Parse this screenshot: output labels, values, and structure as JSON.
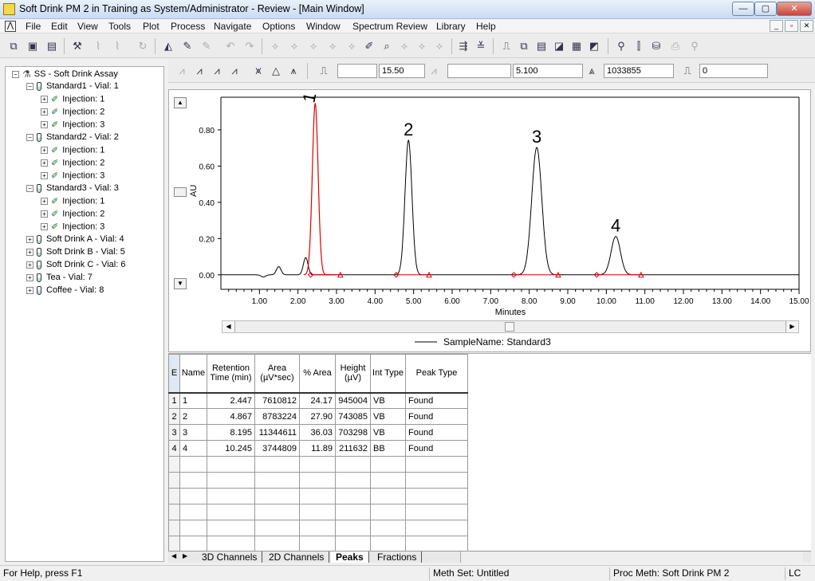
{
  "window": {
    "title": "Soft Drink PM 2 in Training as System/Administrator - Review - [Main Window]",
    "minimize": "—",
    "maximize": "▢",
    "close": "✕"
  },
  "menu": [
    "File",
    "Edit",
    "View",
    "Tools",
    "Plot",
    "Process",
    "Navigate",
    "Options",
    "Window",
    "Spectrum Review",
    "Library",
    "Help"
  ],
  "toolbar2": {
    "field1": "",
    "field2": "15.50",
    "field3": "",
    "field4": "5.100",
    "field5": "1033855",
    "field6": "0"
  },
  "tree": [
    {
      "level": 0,
      "expand": "−",
      "icon": "folder",
      "label": "SS - Soft Drink Assay"
    },
    {
      "level": 1,
      "expand": "−",
      "icon": "vial",
      "label": "Standard1 - Vial: 1"
    },
    {
      "level": 2,
      "expand": "+",
      "icon": "inj",
      "label": "Injection: 1"
    },
    {
      "level": 2,
      "expand": "+",
      "icon": "inj",
      "label": "Injection: 2"
    },
    {
      "level": 2,
      "expand": "+",
      "icon": "inj",
      "label": "Injection: 3"
    },
    {
      "level": 1,
      "expand": "−",
      "icon": "vial",
      "label": "Standard2 - Vial: 2"
    },
    {
      "level": 2,
      "expand": "+",
      "icon": "inj",
      "label": "Injection: 1"
    },
    {
      "level": 2,
      "expand": "+",
      "icon": "inj",
      "label": "Injection: 2"
    },
    {
      "level": 2,
      "expand": "+",
      "icon": "inj",
      "label": "Injection: 3"
    },
    {
      "level": 1,
      "expand": "−",
      "icon": "vial",
      "label": "Standard3 - Vial: 3"
    },
    {
      "level": 2,
      "expand": "+",
      "icon": "inj",
      "label": "Injection: 1"
    },
    {
      "level": 2,
      "expand": "+",
      "icon": "inj",
      "label": "Injection: 2"
    },
    {
      "level": 2,
      "expand": "+",
      "icon": "inj",
      "label": "Injection: 3"
    },
    {
      "level": 1,
      "expand": "+",
      "icon": "vial",
      "label": "Soft Drink A - Vial: 4"
    },
    {
      "level": 1,
      "expand": "+",
      "icon": "vial",
      "label": "Soft Drink B - Vial: 5"
    },
    {
      "level": 1,
      "expand": "+",
      "icon": "vial",
      "label": "Soft Drink C - Vial: 6"
    },
    {
      "level": 1,
      "expand": "+",
      "icon": "vial",
      "label": "Tea - Vial: 7"
    },
    {
      "level": 1,
      "expand": "+",
      "icon": "vial",
      "label": "Coffee - Vial: 8"
    }
  ],
  "chart_data": {
    "type": "line",
    "ylabel": "AU",
    "xlabel": "Minutes",
    "legend": "SampleName: Standard3",
    "xlim": [
      0.0,
      15.0
    ],
    "ylim": [
      -0.08,
      0.98
    ],
    "xticks": [
      "1.00",
      "2.00",
      "3.00",
      "4.00",
      "5.00",
      "6.00",
      "7.00",
      "8.00",
      "9.00",
      "10.00",
      "11.00",
      "12.00",
      "13.00",
      "14.00",
      "15.00"
    ],
    "yticks": [
      "0.00",
      "0.20",
      "0.40",
      "0.60",
      "0.80"
    ],
    "peaks": [
      {
        "label": "1",
        "rt": 2.447,
        "height": 0.945,
        "width": 0.075,
        "start": 2.33,
        "end": 3.1,
        "color": "#dd0000"
      },
      {
        "label": "2",
        "rt": 4.867,
        "height": 0.743,
        "width": 0.09,
        "start": 4.55,
        "end": 5.4,
        "color": "#000000"
      },
      {
        "label": "3",
        "rt": 8.195,
        "height": 0.703,
        "width": 0.13,
        "start": 7.6,
        "end": 8.75,
        "color": "#000000"
      },
      {
        "label": "4",
        "rt": 10.245,
        "height": 0.212,
        "width": 0.12,
        "start": 9.75,
        "end": 10.9,
        "color": "#000000"
      }
    ],
    "baseline_bumps": [
      {
        "rt": 1.1,
        "height": -0.012
      },
      {
        "rt": 1.5,
        "height": 0.045
      },
      {
        "rt": 2.2,
        "height": 0.095
      }
    ]
  },
  "table": {
    "corner": "E",
    "headers": [
      "Name",
      "Retention Time (min)",
      "Area (µV*sec)",
      "% Area",
      "Height (µV)",
      "Int Type",
      "Peak Type"
    ],
    "rows": [
      [
        "1",
        "1",
        "2.447",
        "7610812",
        "24.17",
        "945004",
        "VB",
        "Found"
      ],
      [
        "2",
        "2",
        "4.867",
        "8783224",
        "27.90",
        "743085",
        "VB",
        "Found"
      ],
      [
        "3",
        "3",
        "8.195",
        "11344611",
        "36.03",
        "703298",
        "VB",
        "Found"
      ],
      [
        "4",
        "4",
        "10.245",
        "3744809",
        "11.89",
        "211632",
        "BB",
        "Found"
      ]
    ],
    "empty_rows": 6
  },
  "tabs": [
    "3D Channels",
    "2D Channels",
    "Peaks",
    "Fractions"
  ],
  "active_tab": "Peaks",
  "status": {
    "help": "For Help, press F1",
    "meth_set": "Meth Set: Untitled",
    "proc_meth": "Proc Meth: Soft Drink PM 2",
    "mode": "LC"
  }
}
